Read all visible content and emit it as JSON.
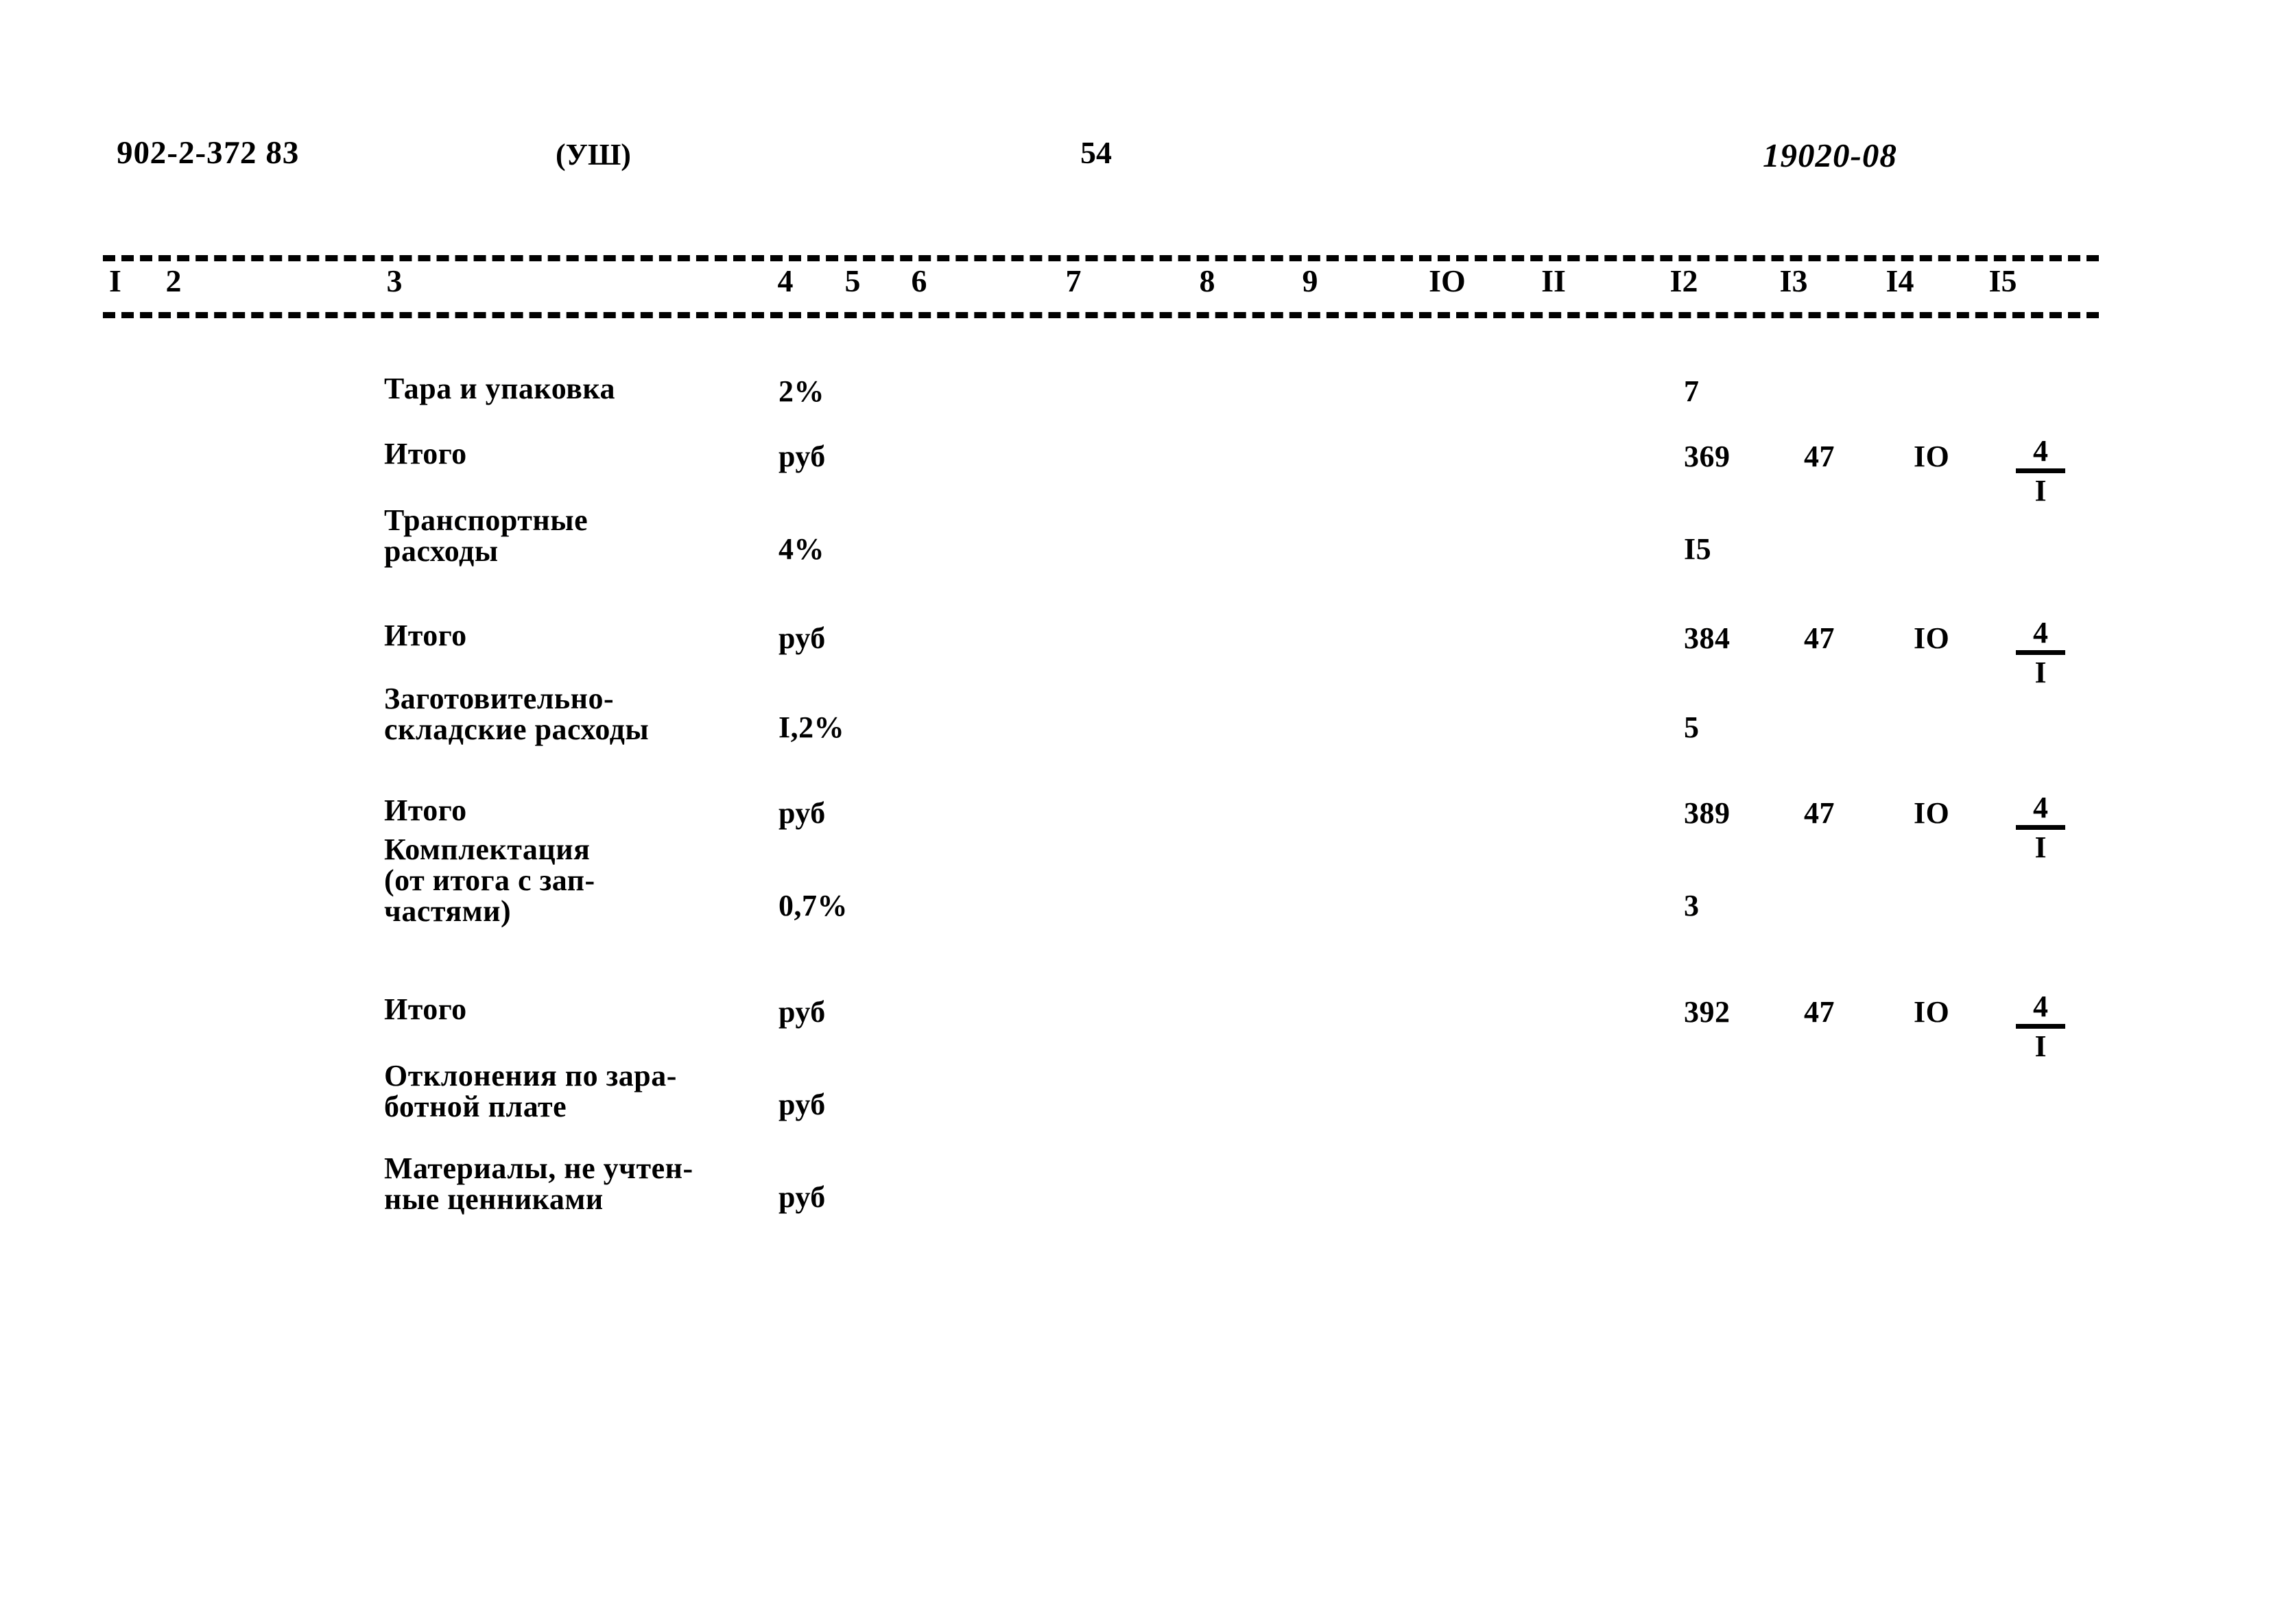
{
  "header": {
    "doc_code": "902-2-372 83",
    "section": "(УШ)",
    "page_number": "54",
    "sheet_code": "19020-08"
  },
  "column_headers": [
    "I",
    "2",
    "3",
    "4",
    "5",
    "6",
    "7",
    "8",
    "9",
    "IO",
    "II",
    "I2",
    "I3",
    "I4",
    "I5"
  ],
  "rows": [
    {
      "name": "Тара и упаковка",
      "unit": "2%",
      "col12": "7",
      "col13": "",
      "col14": "",
      "col15_num": "",
      "col15_den": ""
    },
    {
      "name": "Итого",
      "unit": "руб",
      "col12": "369",
      "col13": "47",
      "col14": "IO",
      "col15_num": "4",
      "col15_den": "I"
    },
    {
      "name": "Транспортные\nрасходы",
      "unit": "4%",
      "col12": "I5",
      "col13": "",
      "col14": "",
      "col15_num": "",
      "col15_den": ""
    },
    {
      "name": "Итого",
      "unit": "руб",
      "col12": "384",
      "col13": "47",
      "col14": "IO",
      "col15_num": "4",
      "col15_den": "I"
    },
    {
      "name": "Заготовительно-\nскладские расходы",
      "unit": "I,2%",
      "col12": "5",
      "col13": "",
      "col14": "",
      "col15_num": "",
      "col15_den": ""
    },
    {
      "name": "Итого",
      "unit": "руб",
      "col12": "389",
      "col13": "47",
      "col14": "IO",
      "col15_num": "4",
      "col15_den": "I"
    },
    {
      "name": "Комплектация\n(от итога с зап-\nчастями)",
      "unit": "0,7%",
      "col12": "3",
      "col13": "",
      "col14": "",
      "col15_num": "",
      "col15_den": ""
    },
    {
      "name": "Итого",
      "unit": "руб",
      "col12": "392",
      "col13": "47",
      "col14": "IO",
      "col15_num": "4",
      "col15_den": "I"
    },
    {
      "name": "Отклонения по зара-\nботной плате",
      "unit": "руб",
      "col12": "",
      "col13": "",
      "col14": "",
      "col15_num": "",
      "col15_den": ""
    },
    {
      "name": "Материалы, не учтен-\nные ценниками",
      "unit": "руб",
      "col12": "",
      "col13": "",
      "col14": "",
      "col15_num": "",
      "col15_den": ""
    }
  ],
  "layout": {
    "column_header_x": [
      168,
      253,
      575,
      1145,
      1243,
      1340,
      1565,
      1760,
      1910,
      2110,
      2265,
      2455,
      2615,
      2770,
      2920
    ],
    "row_tops": [
      0,
      95,
      230,
      360,
      490,
      615,
      750,
      905,
      1040,
      1175
    ],
    "name_offsets": [
      0,
      0,
      -38,
      0,
      -38,
      0,
      -78,
      0,
      -38,
      -38
    ],
    "unit_offsets": [
      0,
      0,
      0,
      0,
      0,
      0,
      0,
      0,
      0,
      0
    ],
    "value_offsets": [
      0,
      0,
      0,
      0,
      0,
      0,
      0,
      0,
      0,
      0
    ]
  }
}
